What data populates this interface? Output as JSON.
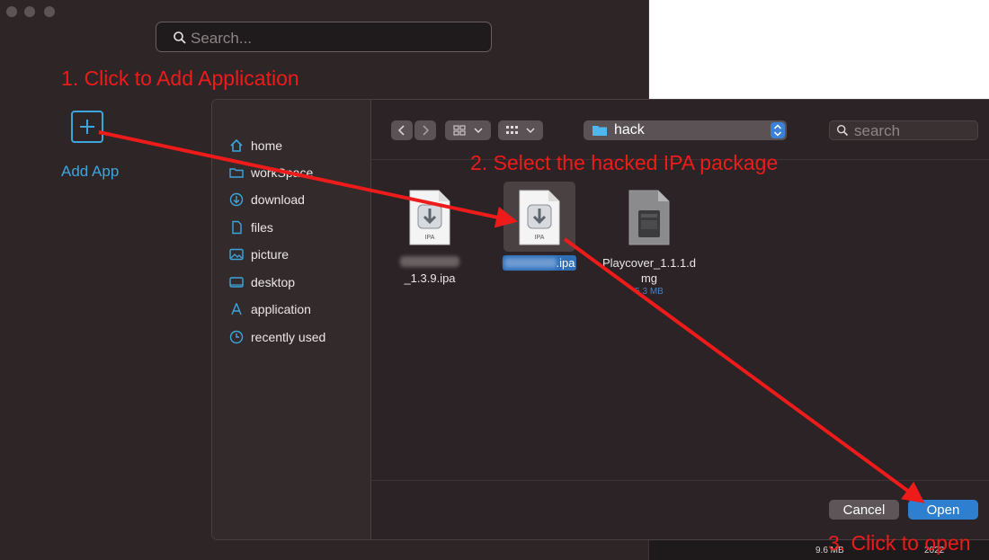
{
  "app": {
    "search_placeholder": "Search...",
    "add_app_label": "Add App"
  },
  "annotations": {
    "step1": "1. Click to Add Application",
    "step2": "2. Select the hacked IPA package",
    "step3": "3. Click to open"
  },
  "dialog": {
    "sidebar": [
      {
        "label": "home",
        "icon": "home-icon"
      },
      {
        "label": "workSpace",
        "icon": "folder-icon"
      },
      {
        "label": "download",
        "icon": "download-icon"
      },
      {
        "label": "files",
        "icon": "document-icon"
      },
      {
        "label": "picture",
        "icon": "picture-icon"
      },
      {
        "label": "desktop",
        "icon": "desktop-icon"
      },
      {
        "label": "application",
        "icon": "application-icon"
      },
      {
        "label": "recently used",
        "icon": "clock-icon"
      }
    ],
    "path_label": "hack",
    "search_placeholder": "search",
    "files": [
      {
        "name_line2": "_1.3.9.ipa",
        "icon_label": "IPA"
      },
      {
        "name_visible": ".ipa",
        "icon_label": "IPA"
      },
      {
        "name_line1": "Playcover_1.1.1.d",
        "name_line2": "mg",
        "size": "5.3 MB"
      }
    ],
    "cancel_label": "Cancel",
    "open_label": "Open"
  },
  "background_strip": {
    "size": "9.6 MB",
    "year": "2022"
  },
  "colors": {
    "accent": "#3ea5dc",
    "annotation": "#ee1b1b",
    "open_button": "#2e7fd0"
  }
}
